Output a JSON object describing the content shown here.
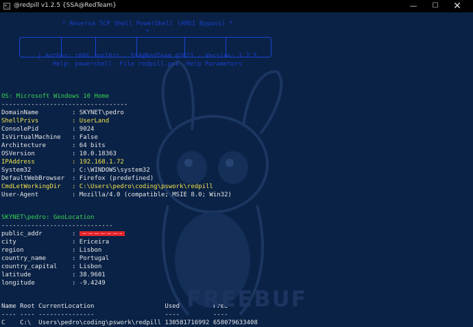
{
  "window": {
    "title": "@redpill v1.2.5 {SSA@RedTeam}",
    "app_icon": ">_",
    "minimize": "—",
    "maximize": "☐",
    "close": "✕"
  },
  "banner": {
    "line1": "* Reverse TCP Shell PowerShell (AMSI Bypass) *",
    "line2": "*",
    "line3": "| Author: r00t-3xp10it - SSA@RedTeam @2021 - Version: 1.2.5",
    "line4": "Help: powershell -File redpill.ps1 -Help Parameters"
  },
  "os": {
    "header": "OS: Microsoft Windows 10 Home",
    "rule": "----------------------------------",
    "rows": [
      {
        "key": "DomainName",
        "value": "SKYNET\\pedro",
        "color": "white"
      },
      {
        "key": "ShellPrivs",
        "value": "UserLand",
        "color": "yellow"
      },
      {
        "key": "ConsolePid",
        "value": "9024",
        "color": "white"
      },
      {
        "key": "IsVirtualMachine",
        "value": "False",
        "color": "white"
      },
      {
        "key": "Architecture",
        "value": "64 bits",
        "color": "white"
      },
      {
        "key": "OSVersion",
        "value": "10.0.18363",
        "color": "white"
      },
      {
        "key": "IPAddress",
        "value": "192.168.1.72",
        "color": "yellow"
      },
      {
        "key": "System32",
        "value": "C:\\WINDOWS\\system32",
        "color": "white"
      },
      {
        "key": "DefaultWebBrowser",
        "value": "Firefox (predefined)",
        "color": "white"
      },
      {
        "key": "CmdLetWorkingDir",
        "value": "C:\\Users\\pedro\\coding\\pswork\\redpill",
        "color": "yellow"
      },
      {
        "key": "User-Agent",
        "value": "Mozilla/4.0 (compatible; MSIE 8.0; Win32)",
        "color": "white"
      }
    ]
  },
  "geo": {
    "header": "SKYNET\\pedro: GeoLocation",
    "rule": "------------------------------",
    "public_addr_key": "public_addr",
    "rows": [
      {
        "key": "city",
        "value": "Ericeira"
      },
      {
        "key": "region",
        "value": "Lisbon"
      },
      {
        "key": "country_name",
        "value": "Portugal"
      },
      {
        "key": "country_capital",
        "value": "Lisbon"
      },
      {
        "key": "latitude",
        "value": "38.9601"
      },
      {
        "key": "longitude",
        "value": "-9.4249"
      }
    ]
  },
  "drives": {
    "header": "Name Root CurrentLocation                   Used         Free",
    "rule": "---- ---- ---------------                   ----         ----",
    "row": "C    C:\\  Users\\pedro\\coding\\pswork\\redpill 130581716992 658079633408"
  },
  "watermark": "FREEBUF",
  "colors": {
    "background": "#0a2246",
    "green": "#39d353",
    "yellow": "#f2e34b",
    "banner_blue": "#1a3fc8",
    "redaction": "#e3242b"
  }
}
